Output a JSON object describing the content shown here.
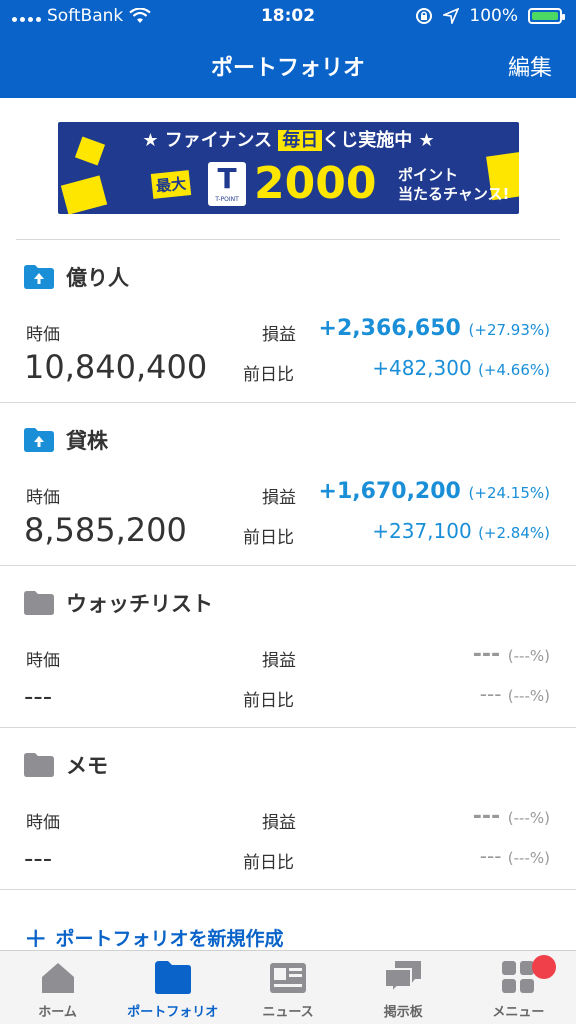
{
  "status": {
    "carrier": "SoftBank",
    "time": "18:02",
    "battery": "100%"
  },
  "nav": {
    "title": "ポートフォリオ",
    "edit_label": "編集"
  },
  "banner": {
    "line1_a": "★ ファイナンス ",
    "line1_hl": "毎日",
    "line1_b": "くじ実施中 ★",
    "max_label": "最大",
    "logo_letter": "T",
    "logo_text": "T-POINT",
    "amount": "2000",
    "sub1": "ポイント",
    "sub2": "当たるチャンス!"
  },
  "sections": [
    {
      "name": "億り人",
      "icon": "folder-up-icon",
      "jika_label": "時価",
      "jika": "10,840,400",
      "soneki_label": "損益",
      "soneki": "+2,366,650",
      "soneki_pct": "(+27.93%)",
      "zen_label": "前日比",
      "zen": "+482,300",
      "zen_pct": "(+4.66%)"
    },
    {
      "name": "貸株",
      "icon": "folder-up-icon",
      "jika_label": "時価",
      "jika": "8,585,200",
      "soneki_label": "損益",
      "soneki": "+1,670,200",
      "soneki_pct": "(+24.15%)",
      "zen_label": "前日比",
      "zen": "+237,100",
      "zen_pct": "(+2.84%)"
    },
    {
      "name": "ウォッチリスト",
      "icon": "folder-icon",
      "jika_label": "時価",
      "jika": "---",
      "soneki_label": "損益",
      "soneki": "---",
      "soneki_pct": "(---%)",
      "zen_label": "前日比",
      "zen": "---",
      "zen_pct": "(---%)"
    },
    {
      "name": "メモ",
      "icon": "folder-icon",
      "jika_label": "時価",
      "jika": "---",
      "soneki_label": "損益",
      "soneki": "---",
      "soneki_pct": "(---%)",
      "zen_label": "前日比",
      "zen": "---",
      "zen_pct": "(---%)"
    }
  ],
  "create_label": "ポートフォリオを新規作成",
  "tabs": [
    {
      "label": "ホーム",
      "icon": "home-icon"
    },
    {
      "label": "ポートフォリオ",
      "icon": "folder-icon",
      "active": true
    },
    {
      "label": "ニュース",
      "icon": "news-icon"
    },
    {
      "label": "掲示板",
      "icon": "chat-icon"
    },
    {
      "label": "メニュー",
      "icon": "grid-menu-icon"
    }
  ],
  "colors": {
    "brand": "#0a63c9",
    "positive": "#1a8fd8",
    "badge": "#f0404a"
  }
}
